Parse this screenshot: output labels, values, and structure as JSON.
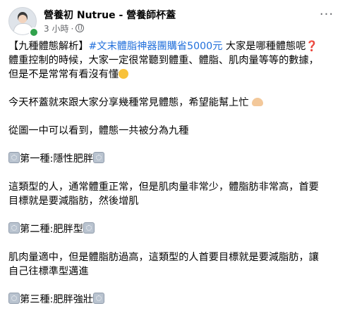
{
  "header": {
    "page_name": "營養初 Nutrue - 營養師杯蓋",
    "time": "3 小時",
    "separator": "·"
  },
  "post": {
    "line1_prefix": "【九種體態解析】",
    "line1_hashtag": "#文末體脂神器團購省5000元",
    "line1_suffix": " 大家是哪種體態呢",
    "line1_emoji": "❓",
    "line2": "體重控制的時候，大家一定很常聽到體重、體脂、肌肉量等等的數據，",
    "line3": "但是不是常常有看沒有懂",
    "para2": "今天杯蓋就來跟大家分享幾種常見體態，希望能幫上忙",
    "para3": "從圖一中可以看到，體態一共被分為九種",
    "type1": "第一種:隱性肥胖",
    "type1_desc_a": "這類型的人，通常體重正常，但是肌肉量非常少，體脂肪非常高，首要",
    "type1_desc_b": "目標就是要減脂肪，然後增肌",
    "type2": "第二種:肥胖型",
    "type2_desc_a": "肌肉量適中，但是體脂肪過高，這類型的人首要目標就是要減脂肪，讓",
    "type2_desc_b": "自己往標準型邁進",
    "type3": "第三種:肥胖強壯"
  }
}
